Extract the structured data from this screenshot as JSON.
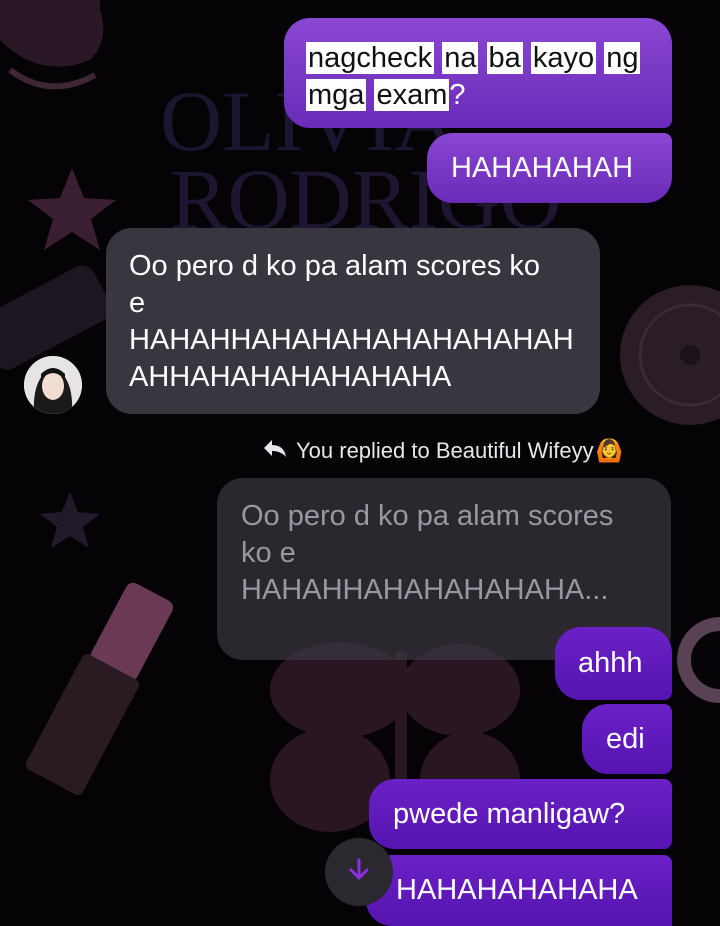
{
  "messages": {
    "sent_1": {
      "words": [
        "nagcheck",
        "na",
        "ba",
        "kayo",
        "ng",
        "mga",
        "exam"
      ],
      "punct": "?"
    },
    "sent_2": "HAHAHAHAH",
    "received_1": {
      "line1": "Oo pero d ko pa alam scores ko",
      "line2": "e",
      "line3": "HAHAHHAHAHAHAHAHAHAHAH",
      "line4": "AHHAHAHAHAHAHAHA"
    },
    "reply_label": "You replied to Beautiful Wifeyy",
    "reply_emoji": "🙆",
    "quoted": {
      "line1": "Oo pero d ko pa alam scores",
      "line2": "ko e",
      "line3": "HAHAHHAHAHAHAHAHA..."
    },
    "sent_3": "ahhh",
    "sent_4": "edi",
    "sent_5": "pwede manligaw?",
    "sent_6": "HAHAHAHAHAHA"
  },
  "icons": {
    "reply": "reply-arrow-icon",
    "scroll_down": "arrow-down-icon"
  },
  "colors": {
    "sent_bubble": "#7a3bc8",
    "received_bubble": "#3a3640",
    "background": "#050306",
    "accent": "#8b2ee6"
  }
}
